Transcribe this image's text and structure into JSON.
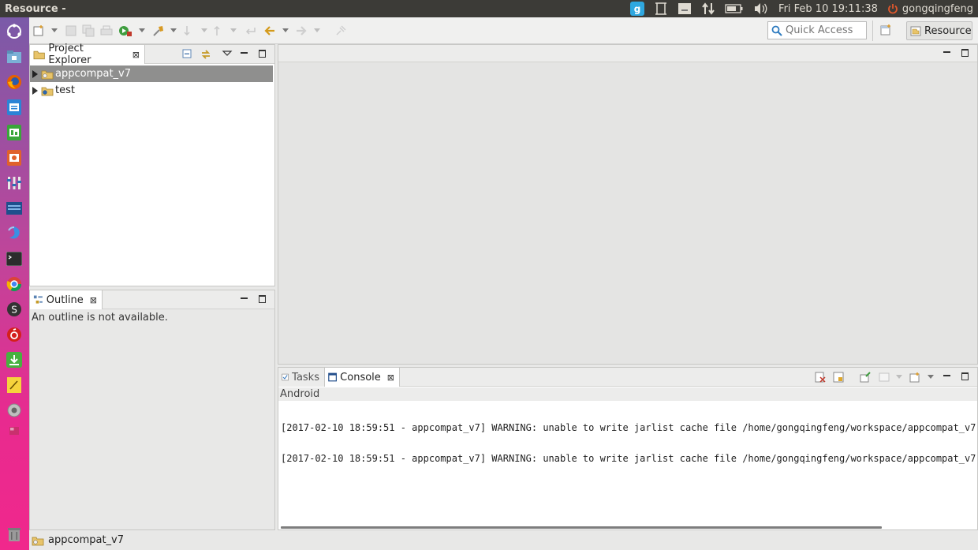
{
  "top_panel": {
    "window_title": "Resource -",
    "clock": "Fri Feb 10 19:11:38",
    "user": "gongqingfeng",
    "icons": [
      "sogou-input-icon",
      "screenshot-icon",
      "keyboard-icon",
      "network-icon",
      "battery-icon",
      "volume-icon",
      "power-icon"
    ]
  },
  "launcher": {
    "icons": [
      "ubuntu-dash-icon",
      "files-icon",
      "firefox-icon",
      "writer-icon",
      "calc-icon",
      "impress-icon",
      "settings-tools-icon",
      "sqlitebrowser-icon",
      "deepin-icon",
      "terminal-icon",
      "chrome-icon",
      "steam-icon",
      "netease-music-icon",
      "software-updater-icon",
      "notes-icon",
      "system-settings-icon",
      "workspace-icon",
      "trash-icon"
    ]
  },
  "toolbar": {
    "quick_access_placeholder": "Quick Access",
    "perspective_label": "Resource"
  },
  "project_explorer": {
    "tab_label": "Project Explorer",
    "items": [
      {
        "label": "appcompat_v7",
        "selected": true
      },
      {
        "label": "test",
        "selected": false
      }
    ]
  },
  "outline": {
    "tab_label": "Outline",
    "message": "An outline is not available."
  },
  "bottom_panel": {
    "tasks_tab": "Tasks",
    "console_tab": "Console",
    "console_name": "Android",
    "lines": [
      "[2017-02-10 18:59:51 - appcompat_v7] WARNING: unable to write jarlist cache file /home/gongqingfeng/workspace/appcompat_v7",
      "[2017-02-10 18:59:51 - appcompat_v7] WARNING: unable to write jarlist cache file /home/gongqingfeng/workspace/appcompat_v7"
    ]
  },
  "status_bar": {
    "selection": "appcompat_v7"
  },
  "colors": {
    "top_panel": "#3c3b37",
    "launcher_top": "#7a5aa8",
    "launcher_bottom": "#f0288c",
    "selection": "#8f8f8e"
  }
}
